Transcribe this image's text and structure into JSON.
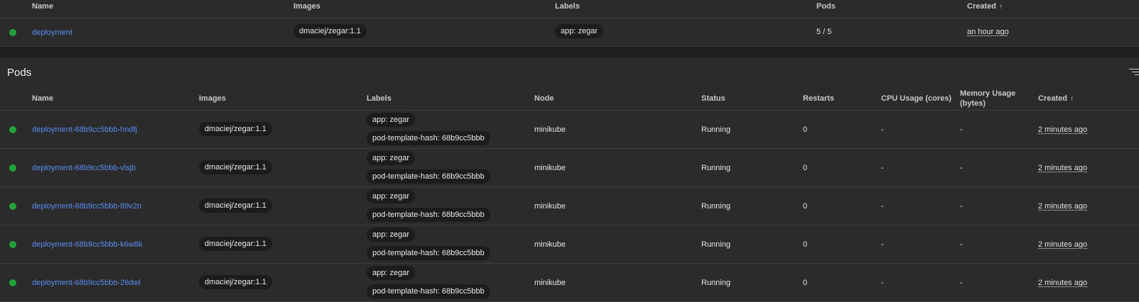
{
  "deployments": {
    "headers": {
      "name": "Name",
      "images": "Images",
      "labels": "Labels",
      "pods": "Pods",
      "created": "Created"
    },
    "sort_arrow": "↑",
    "row": {
      "status_color": "#21a13a",
      "name": "deployment",
      "image": "dmaciej/zegar:1.1",
      "label": "app: zegar",
      "pods": "5 / 5",
      "created": "an hour ago"
    }
  },
  "pods": {
    "title": "Pods",
    "headers": {
      "name": "Name",
      "images": "Images",
      "labels": "Labels",
      "node": "Node",
      "status": "Status",
      "restarts": "Restarts",
      "cpu": "CPU Usage (cores)",
      "memory_line1": "Memory Usage",
      "memory_line2": "(bytes)",
      "created": "Created"
    },
    "sort_arrow": "↑",
    "rows": [
      {
        "name": "deployment-68b9cc5bbb-hndfj",
        "image": "dmaciej/zegar:1.1",
        "label1": "app: zegar",
        "label2": "pod-template-hash: 68b9cc5bbb",
        "node": "minikube",
        "status": "Running",
        "restarts": "0",
        "cpu": "-",
        "memory": "-",
        "created": "2 minutes ago"
      },
      {
        "name": "deployment-68b9cc5bbb-vlsjb",
        "image": "dmaciej/zegar:1.1",
        "label1": "app: zegar",
        "label2": "pod-template-hash: 68b9cc5bbb",
        "node": "minikube",
        "status": "Running",
        "restarts": "0",
        "cpu": "-",
        "memory": "-",
        "created": "2 minutes ago"
      },
      {
        "name": "deployment-68b9cc5bbb-89v2n",
        "image": "dmaciej/zegar:1.1",
        "label1": "app: zegar",
        "label2": "pod-template-hash: 68b9cc5bbb",
        "node": "minikube",
        "status": "Running",
        "restarts": "0",
        "cpu": "-",
        "memory": "-",
        "created": "2 minutes ago"
      },
      {
        "name": "deployment-68b9cc5bbb-k6w8k",
        "image": "dmaciej/zegar:1.1",
        "label1": "app: zegar",
        "label2": "pod-template-hash: 68b9cc5bbb",
        "node": "minikube",
        "status": "Running",
        "restarts": "0",
        "cpu": "-",
        "memory": "-",
        "created": "2 minutes ago"
      },
      {
        "name": "deployment-68b9cc5bbb-26dwl",
        "image": "dmaciej/zegar:1.1",
        "label1": "app: zegar",
        "label2": "pod-template-hash: 68b9cc5bbb",
        "node": "minikube",
        "status": "Running",
        "restarts": "0",
        "cpu": "-",
        "memory": "-",
        "created": "2 minutes ago"
      }
    ]
  },
  "icons": {
    "status": "status-running-icon",
    "filter": "filter-icon",
    "sort": "sort-arrow-up-icon"
  }
}
